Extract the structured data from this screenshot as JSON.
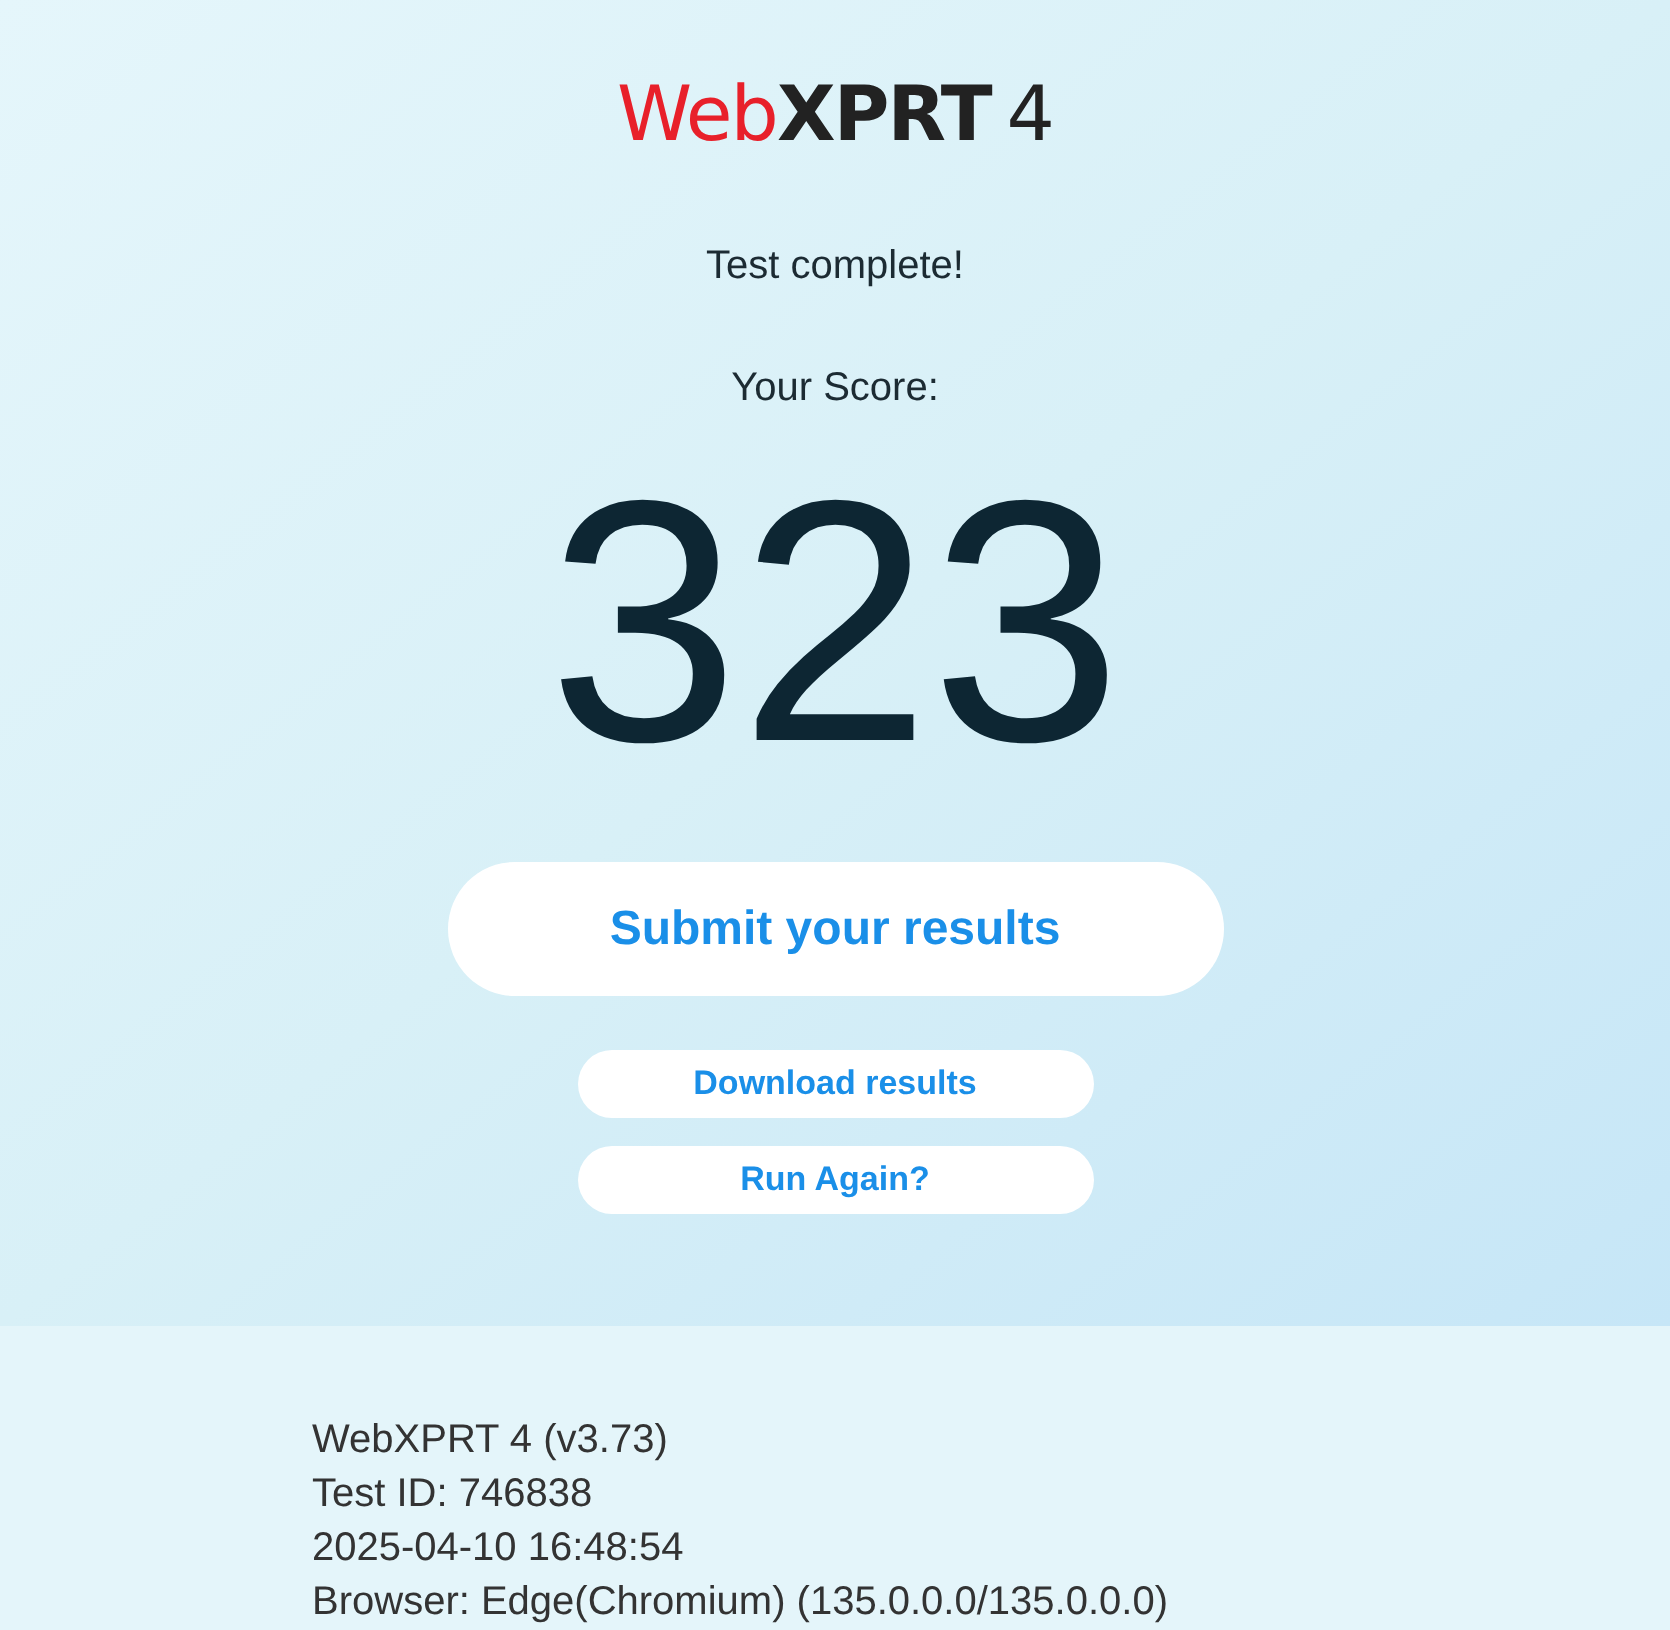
{
  "logo": [
    {
      "text": "Web",
      "kind": "accent"
    },
    {
      "text": "XPRT",
      "kind": "bold"
    },
    {
      "text": "4",
      "kind": "plain"
    }
  ],
  "status": "Test complete!",
  "score_label": "Your Score:",
  "score": "323",
  "buttons": [
    {
      "label": "Submit your results",
      "kind": "primary"
    },
    {
      "label": "Download results",
      "kind": "secondary"
    },
    {
      "label": "Run Again?",
      "kind": "secondary"
    }
  ],
  "info_lines": [
    "WebXPRT 4 (v3.73)",
    "Test ID: 746838",
    "2025-04-10 16:48:54",
    "Browser: Edge(Chromium) (135.0.0.0/135.0.0.0)"
  ]
}
